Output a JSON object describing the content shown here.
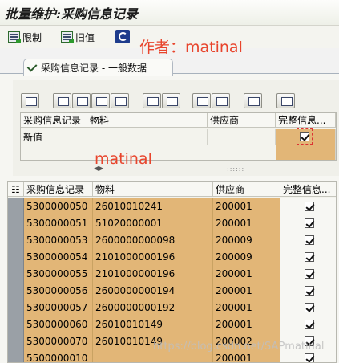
{
  "title": "批量维护:采购信息记录",
  "toolbar": {
    "limit_label": "限制",
    "old_value_label": "旧值"
  },
  "watermarks": {
    "author": "作者：matinal",
    "middle": "matinal",
    "url": "https://blog.csdn.net/SAPmatinal"
  },
  "tab": {
    "label": "采购信息记录 - 一般数据"
  },
  "filter_grid": {
    "columns": [
      "采购信息记录",
      "物料",
      "供应商",
      "完整信息..."
    ],
    "row": {
      "record": "新值",
      "material": "",
      "vendor": "",
      "complete": true
    }
  },
  "main_grid": {
    "columns": [
      "采购信息记录",
      "物料",
      "供应商",
      "完整信息..."
    ],
    "rows": [
      {
        "record": "5300000050",
        "material": "26010010241",
        "vendor": "200001",
        "complete": true
      },
      {
        "record": "5300000051",
        "material": "51020000001",
        "vendor": "200001",
        "complete": true
      },
      {
        "record": "5300000053",
        "material": "2600000000098",
        "vendor": "200009",
        "complete": true
      },
      {
        "record": "5300000054",
        "material": "2101000000196",
        "vendor": "200009",
        "complete": true
      },
      {
        "record": "5300000055",
        "material": "2101000000196",
        "vendor": "200001",
        "complete": true
      },
      {
        "record": "5300000056",
        "material": "2600000000194",
        "vendor": "200001",
        "complete": true
      },
      {
        "record": "5300000057",
        "material": "2600000000192",
        "vendor": "200001",
        "complete": true
      },
      {
        "record": "5300000060",
        "material": "26010010149",
        "vendor": "200001",
        "complete": true
      },
      {
        "record": "5300000070",
        "material": "26010010149",
        "vendor": "200002",
        "complete": true
      },
      {
        "record": "5500000010",
        "material": "",
        "vendor": "200001",
        "complete": true
      }
    ]
  }
}
